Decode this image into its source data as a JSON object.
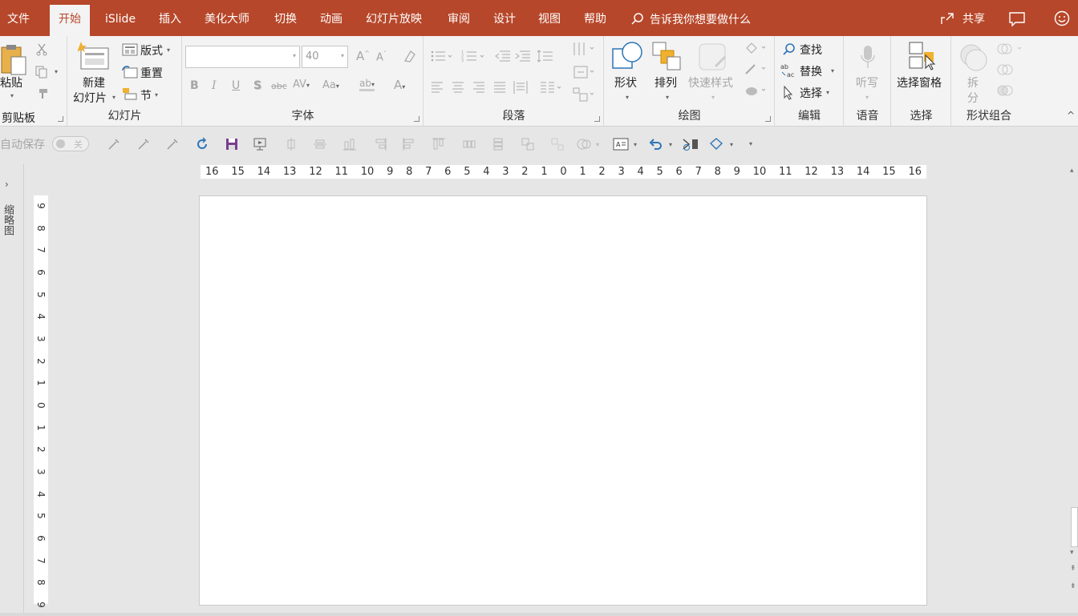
{
  "menu": {
    "tabs": [
      {
        "label": "文件"
      },
      {
        "label": "开始"
      },
      {
        "label": "iSlide"
      },
      {
        "label": "插入"
      },
      {
        "label": "美化大师"
      },
      {
        "label": "切换"
      },
      {
        "label": "动画"
      },
      {
        "label": "幻灯片放映"
      },
      {
        "label": "审阅"
      },
      {
        "label": "设计"
      },
      {
        "label": "视图"
      },
      {
        "label": "帮助"
      }
    ],
    "active_tab": "开始",
    "tell_me": "告诉我你想要做什么",
    "share": "共享"
  },
  "ribbon": {
    "clipboard": {
      "paste": "粘贴",
      "group": "剪贴板"
    },
    "slides": {
      "new_slide_1": "新建",
      "new_slide_2": "幻灯片",
      "layout": "版式",
      "reset": "重置",
      "section": "节",
      "group": "幻灯片"
    },
    "font": {
      "font_name": "",
      "font_size": "40",
      "group": "字体"
    },
    "paragraph": {
      "group": "段落"
    },
    "drawing": {
      "shapes": "形状",
      "arrange": "排列",
      "quick_styles": "快速样式",
      "group": "绘图"
    },
    "editing": {
      "find": "查找",
      "replace": "替换",
      "select": "选择",
      "group": "编辑"
    },
    "voice": {
      "dictate": "听写",
      "group": "语音"
    },
    "selection": {
      "selection_pane": "选择窗格",
      "group": "选择"
    },
    "shape_combine": {
      "split_1": "拆",
      "split_2": "分",
      "group": "形状组合"
    }
  },
  "qat": {
    "autosave": "自动保存",
    "autosave_state": "关"
  },
  "thumbnails": {
    "label": "缩略图"
  },
  "ruler": {
    "horizontal": [
      "16",
      "15",
      "14",
      "13",
      "12",
      "11",
      "10",
      "9",
      "8",
      "7",
      "6",
      "5",
      "4",
      "3",
      "2",
      "1",
      "0",
      "1",
      "2",
      "3",
      "4",
      "5",
      "6",
      "7",
      "8",
      "9",
      "10",
      "11",
      "12",
      "13",
      "14",
      "15",
      "16"
    ],
    "vertical": [
      "9",
      "8",
      "7",
      "6",
      "5",
      "4",
      "3",
      "2",
      "1",
      "0",
      "1",
      "2",
      "3",
      "4",
      "5",
      "6",
      "7",
      "8",
      "9"
    ]
  },
  "colors": {
    "accent": "#b7472a",
    "ribbon_bg": "#f3f3f3",
    "workspace": "#e6e6e6"
  }
}
